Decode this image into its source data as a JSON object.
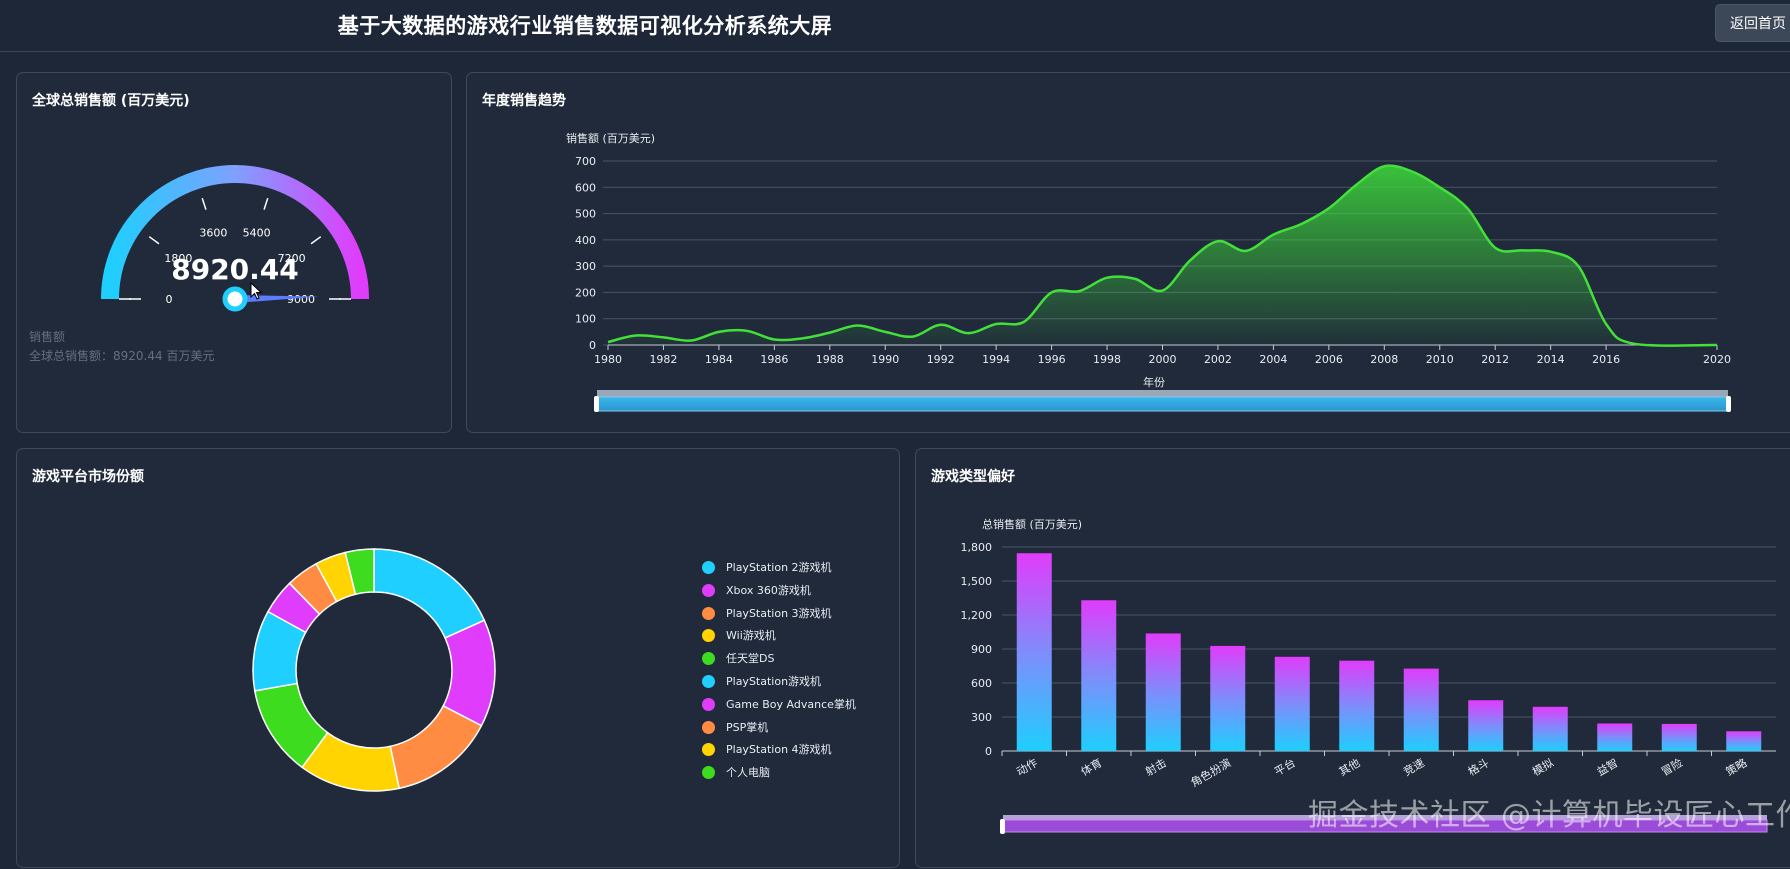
{
  "header": {
    "title": "基于大数据的游戏行业销售数据可视化分析系统大屏",
    "back_label": "返回首页"
  },
  "gauge_panel": {
    "title": "全球总销售额 (百万美元)",
    "value_text": "8920.44",
    "value": 8920.44,
    "max": 9000,
    "ticks": [
      "0",
      "1800",
      "3600",
      "5400",
      "7200",
      "9000"
    ],
    "legend_label": "销售额",
    "summary": "全球总销售额：8920.44 百万美元"
  },
  "trend_panel": {
    "title": "年度销售趋势",
    "ylabel": "销售额 (百万美元)",
    "xlabel": "年份"
  },
  "platform_panel": {
    "title": "游戏平台市场份额"
  },
  "genre_panel": {
    "title": "游戏类型偏好",
    "ylabel": "总销售额 (百万美元)"
  },
  "watermark": "掘金技术社区 @计算机毕设匠心工作室",
  "colors": {
    "background": "#1e2737",
    "panel": "#202a3a",
    "line_green": "#3ddc3a",
    "cyan": "#1ecfff",
    "magenta": "#e03cfb",
    "orange": "#ff8c42",
    "yellow": "#ffd400",
    "green": "#3ddc1f"
  },
  "chart_data": [
    {
      "type": "gauge",
      "title": "全球总销售额 (百万美元)",
      "value": 8920.44,
      "min": 0,
      "max": 9000,
      "tick_labels": [
        "0",
        "1800",
        "3600",
        "5400",
        "7200",
        "9000"
      ],
      "series_name": "销售额"
    },
    {
      "type": "area",
      "title": "年度销售趋势",
      "xlabel": "年份",
      "ylabel": "销售额 (百万美元)",
      "ylim": [
        0,
        700
      ],
      "yticks": [
        0,
        100,
        200,
        300,
        400,
        500,
        600,
        700
      ],
      "xticks": [
        1980,
        1982,
        1984,
        1986,
        1988,
        1990,
        1992,
        1994,
        1996,
        1998,
        2000,
        2002,
        2004,
        2006,
        2008,
        2010,
        2012,
        2014,
        2016,
        2020
      ],
      "x": [
        1980,
        1981,
        1982,
        1983,
        1984,
        1985,
        1986,
        1987,
        1988,
        1989,
        1990,
        1991,
        1992,
        1993,
        1994,
        1995,
        1996,
        1997,
        1998,
        1999,
        2000,
        2001,
        2002,
        2003,
        2004,
        2005,
        2006,
        2007,
        2008,
        2009,
        2010,
        2011,
        2012,
        2013,
        2014,
        2015,
        2016,
        2017,
        2020
      ],
      "values": [
        11,
        36,
        29,
        17,
        50,
        54,
        21,
        25,
        47,
        74,
        50,
        32,
        77,
        45,
        80,
        88,
        200,
        205,
        256,
        252,
        207,
        322,
        395,
        358,
        420,
        460,
        520,
        610,
        680,
        660,
        600,
        520,
        370,
        360,
        355,
        300,
        80,
        5,
        0
      ],
      "grid": true,
      "has_zoom_slider": true
    },
    {
      "type": "pie",
      "title": "游戏平台市场份额",
      "legend_position": "right",
      "labels": [
        "PlayStation 2游戏机",
        "Xbox 360游戏机",
        "PlayStation 3游戏机",
        "Wii游戏机",
        "任天堂DS",
        "PlayStation游戏机",
        "Game Boy Advance掌机",
        "PSP掌机",
        "PlayStation 4游戏机",
        "个人电脑"
      ],
      "values": [
        1233,
        969,
        949,
        909,
        818,
        727,
        317,
        294,
        278,
        258
      ],
      "colors": [
        "#1ecfff",
        "#e03cfb",
        "#ff8c42",
        "#ffd400",
        "#3ddc1f",
        "#1ecfff",
        "#e03cfb",
        "#ff8c42",
        "#ffd400",
        "#3ddc1f"
      ]
    },
    {
      "type": "bar",
      "title": "游戏类型偏好",
      "ylabel": "总销售额 (百万美元)",
      "ylim": [
        0,
        1800
      ],
      "yticks": [
        "0",
        "300",
        "600",
        "900",
        "1,200",
        "1,500",
        "1,800"
      ],
      "categories": [
        "动作",
        "体育",
        "射击",
        "角色扮演",
        "平台",
        "其他",
        "竞速",
        "格斗",
        "模拟",
        "益智",
        "冒险",
        "策略"
      ],
      "values": [
        1745,
        1330,
        1037,
        927,
        831,
        797,
        727,
        448,
        390,
        243,
        239,
        174
      ],
      "has_zoom_slider": true
    }
  ]
}
